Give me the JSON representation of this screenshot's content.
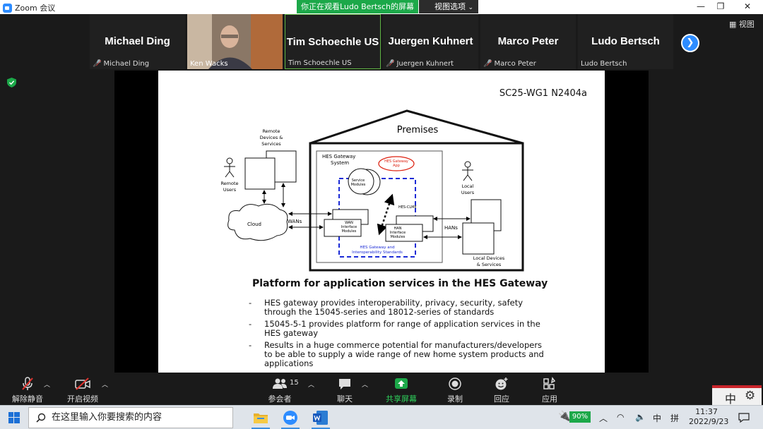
{
  "window": {
    "app_name": "Zoom 会议",
    "share_banner": "你正在观看Ludo Bertsch的屏幕",
    "view_options": "视图选项",
    "view_toggle": "视图"
  },
  "participants": [
    {
      "big_name": "Michael Ding",
      "label": "Michael Ding",
      "muted": true
    },
    {
      "big_name": "",
      "label": "Ken Wacks",
      "muted": false,
      "video": true
    },
    {
      "big_name": "Tim Schoechle US",
      "label": "Tim Schoechle US",
      "muted": false,
      "speaking": true
    },
    {
      "big_name": "Juergen Kuhnert",
      "label": "Juergen Kuhnert",
      "muted": true
    },
    {
      "big_name": "Marco Peter",
      "label": "Marco Peter",
      "muted": true
    },
    {
      "big_name": "Ludo Bertsch",
      "label": "Ludo Bertsch",
      "muted": false
    }
  ],
  "slide": {
    "doc_number": "SC25-WG1 N2404a",
    "title": "Platform for application services in the HES Gateway",
    "bullets": [
      "HES gateway provides interoperability, privacy, security, safety through the 15045-series and 18012-series of standards",
      "15045-5-1 provides platform for range of application services in the HES gateway",
      "Results in a huge commerce potential for manufacturers/developers to be able to supply a wide range of new home system products and applications"
    ],
    "diagram": {
      "premises": "Premises",
      "remote_devices": [
        "Remote",
        "Devices &",
        "Services"
      ],
      "remote_users": [
        "Remote",
        "Users"
      ],
      "cloud": "Cloud",
      "wans": "WANs",
      "gateway_system": [
        "HES Gateway",
        "System"
      ],
      "gateway_app": [
        "HES Gateway",
        "App"
      ],
      "service_modules": [
        "Service",
        "Modules"
      ],
      "hes_clme": "HES-CLME",
      "wan_modules": [
        "WAN",
        "Interface",
        "Modules"
      ],
      "han_modules": [
        "HAN",
        "Interface",
        "Modules"
      ],
      "interop": [
        "HES Gateway and",
        "Interoperability Standards"
      ],
      "hans": "HANs",
      "local_users": [
        "Local",
        "Users"
      ],
      "local_devices": [
        "Local Devices",
        "& Services"
      ]
    }
  },
  "toolbar": {
    "unmute": "解除静音",
    "start_video": "开启视频",
    "participants": "参会者",
    "participant_count": "15",
    "chat": "聊天",
    "share_screen": "共享屏幕",
    "record": "录制",
    "reactions": "回应",
    "apps": "应用"
  },
  "taskbar": {
    "search_placeholder": "在这里输入你要搜索的内容",
    "battery": "90%",
    "ime_lang": "中",
    "ime_mode": "拼",
    "time": "11:37",
    "date": "2022/9/23",
    "ime_box_char": "中"
  },
  "colors": {
    "zoom_blue": "#2d8cff",
    "share_green": "#1ca849",
    "muted_red": "#e0332e"
  }
}
